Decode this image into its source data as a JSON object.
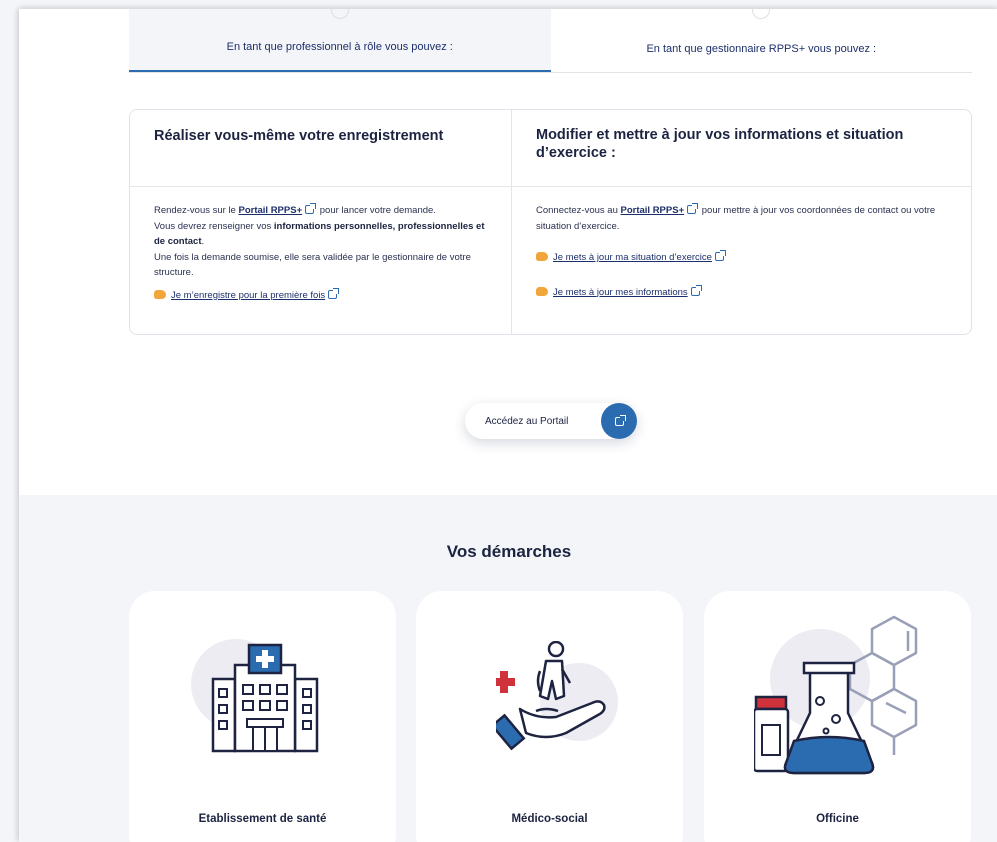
{
  "tabs": [
    {
      "label": "En tant que professionnel à rôle vous pouvez :",
      "active": true
    },
    {
      "label": "En tant que gestionnaire RPPS+ vous pouvez :",
      "active": false
    }
  ],
  "left_column": {
    "title": "Réaliser vous-même votre enregistrement",
    "text_1": "Rendez-vous sur le",
    "portal_link": "Portail RPPS+",
    "text_2": "pour lancer votre demande.",
    "text_3": "Vous devrez renseigner vos",
    "text_bold": "informations personnelles, professionnelles et de contact",
    "text_4": ".",
    "text_5": "Une fois la demande soumise, elle sera validée par le gestionnaire de votre structure.",
    "action": "Je m’enregistre pour la première fois"
  },
  "right_column": {
    "title": "Modifier et mettre à jour vos informations et situation d’exercice :",
    "text_1": "Connectez-vous au",
    "portal_link": "Portail RPPS+",
    "text_2": "pour mettre à jour vos coordonnées de contact ou votre situation d’exercice.",
    "action_1": "Je mets à jour ma situation d’exercice",
    "action_2": "Je mets à jour mes informations"
  },
  "portal_button": {
    "label": "Accédez au Portail"
  },
  "demarches": {
    "title": "Vos démarches",
    "cards": [
      {
        "label": "Etablissement de santé",
        "icon": "hospital-icon"
      },
      {
        "label": "Médico-social",
        "icon": "care-hand-icon"
      },
      {
        "label": "Officine",
        "icon": "pharmacy-flask-icon"
      }
    ]
  },
  "colors": {
    "accent": "#2b6cb0",
    "navy": "#1d2f6b",
    "red": "#d0323b",
    "section_bg": "#f4f5f8"
  }
}
